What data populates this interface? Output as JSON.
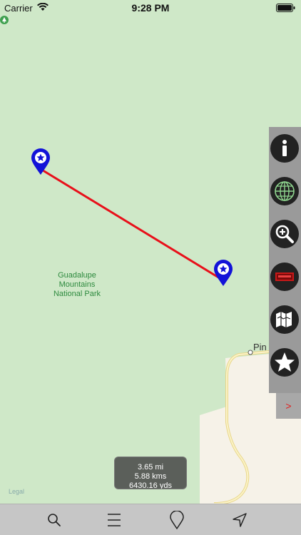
{
  "status": {
    "carrier": "Carrier",
    "time": "9:28 PM"
  },
  "map": {
    "park_label_line1": "Guadalupe",
    "park_label_line2": "Mountains",
    "park_label_line3": "National Park",
    "place_label": "Pin",
    "legal": "Legal",
    "route_color": "#e8101a",
    "pin_color": "#1212d8"
  },
  "distance": {
    "miles": "3.65 mi",
    "kms": "5.88 kms",
    "yds": "6430.16 yds"
  },
  "toolbar": {
    "icons": [
      "info-icon",
      "globe-icon",
      "zoom-in-icon",
      "video-icon",
      "map-icon",
      "star-icon"
    ],
    "expand_label": ">"
  },
  "tabs": [
    "search-icon",
    "list-icon",
    "pin-icon",
    "navigate-icon"
  ]
}
